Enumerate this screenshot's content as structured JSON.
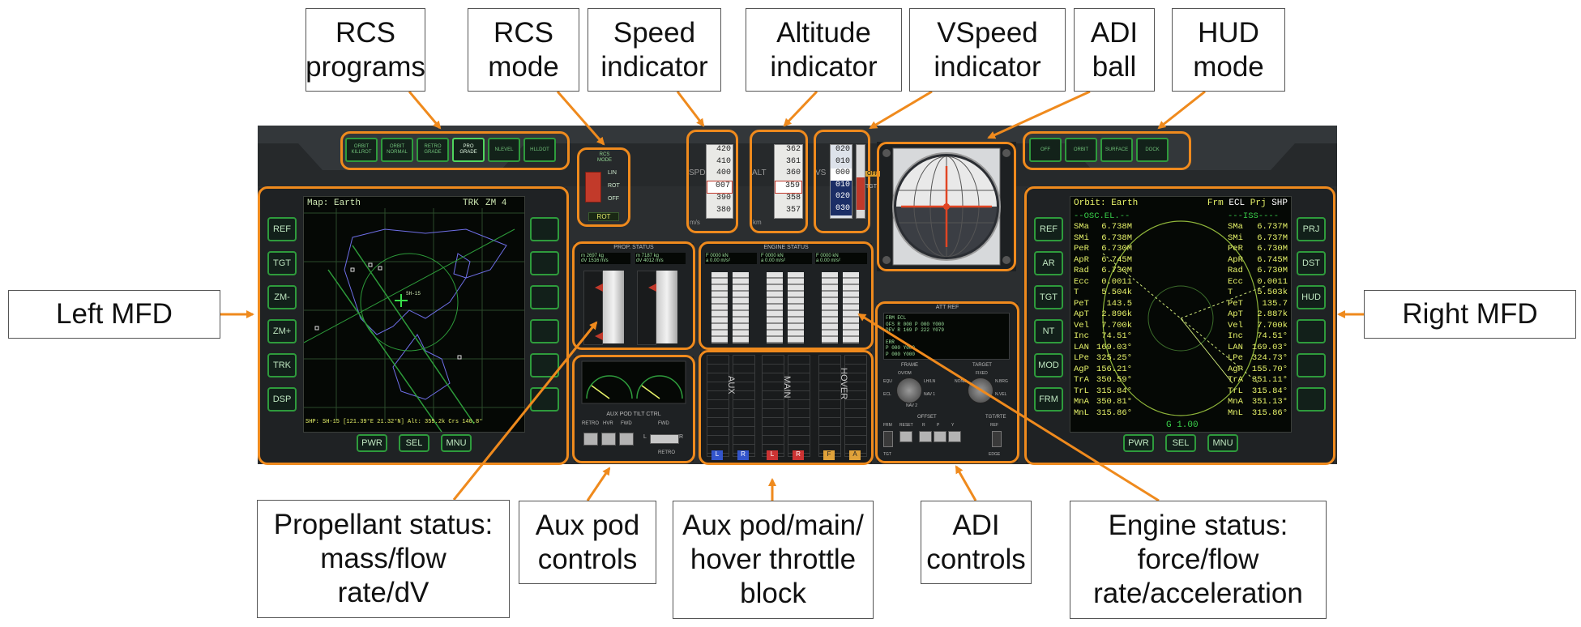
{
  "colors": {
    "highlight": "#ef8a1d",
    "button_green": "#2e9b3c",
    "map_line": "#6f6fe8",
    "orbit_text": "#e8f46a"
  },
  "labels": {
    "rcs_programs": "RCS\nprograms",
    "rcs_mode": "RCS\nmode",
    "speed_indicator": "Speed\nindicator",
    "altitude_indicator": "Altitude\nindicator",
    "vspeed_indicator": "VSpeed\nindicator",
    "adi_ball": "ADI\nball",
    "hud_mode": "HUD\nmode",
    "left_mfd": "Left MFD",
    "right_mfd": "Right MFD",
    "propellant_status": "Propellant status:\nmass/flow\nrate/dV",
    "aux_pod_controls": "Aux pod\ncontrols",
    "throttle_block": "Aux pod/main/\nhover throttle\nblock",
    "adi_controls": "ADI\ncontrols",
    "engine_status": "Engine status:\nforce/flow\nrate/acceleration"
  },
  "rcs_program_buttons": [
    "ORBIT\nKILLROT",
    "ORBIT\nNORMAL",
    "RETRO\nGRADE",
    "PRO\nGRADE",
    "NLEVEL",
    "HLLDOT"
  ],
  "rcs_mode": {
    "title": "RCS\nMODE",
    "lin": "LIN",
    "rot": "ROT",
    "off": "OFF",
    "active": "ROT"
  },
  "hud_buttons": [
    "OFF",
    "ORBIT",
    "SURFACE",
    "DOCK"
  ],
  "left_mfd": {
    "header": "Map: Earth",
    "trk": "TRK",
    "zoom": "ZM 4",
    "footer": "SHP: SH-15 [121.39°E 21.32°N] Alt: 359.2k Crs 140.8°",
    "left_buttons": [
      "REF",
      "TGT",
      "ZM-",
      "ZM+",
      "TRK",
      "DSP"
    ],
    "bottom_buttons": [
      "PWR",
      "SEL",
      "MNU"
    ],
    "target_label": "SH-15"
  },
  "right_mfd": {
    "title": "Orbit: Earth",
    "frm_label": "Frm",
    "frm_value": "ECL",
    "prj_label": "Prj",
    "prj_value": "SHP",
    "osc_header": "--OSC.EL.--",
    "iss_header": "---ISS----",
    "left_col": [
      [
        "SMa",
        "6.738M"
      ],
      [
        "SMi",
        "6.738M"
      ],
      [
        "PeR",
        "6.730M"
      ],
      [
        "ApR",
        "6.745M"
      ],
      [
        "Rad",
        "6.730M"
      ],
      [
        "Ecc",
        "0.0011"
      ],
      [
        "T",
        "5.504k"
      ],
      [
        "PeT",
        "143.5"
      ],
      [
        "ApT",
        "2.896k"
      ],
      [
        "Vel",
        "7.700k"
      ],
      [
        "Inc",
        "74.51°"
      ],
      [
        "LAN",
        "169.03°"
      ],
      [
        "LPe",
        "325.25°"
      ],
      [
        "AgP",
        "156.21°"
      ],
      [
        "TrA",
        "350.59°"
      ],
      [
        "TrL",
        "315.84°"
      ],
      [
        "MnA",
        "350.81°"
      ],
      [
        "MnL",
        "315.86°"
      ]
    ],
    "right_col": [
      [
        "SMa",
        "6.737M"
      ],
      [
        "SMi",
        "6.737M"
      ],
      [
        "PeR",
        "6.730M"
      ],
      [
        "ApR",
        "6.745M"
      ],
      [
        "Rad",
        "6.730M"
      ],
      [
        "Ecc",
        "0.0011"
      ],
      [
        "T",
        "5.503k"
      ],
      [
        "PeT",
        "135.7"
      ],
      [
        "ApT",
        "2.887k"
      ],
      [
        "Vel",
        "7.700k"
      ],
      [
        "Inc",
        "74.51°"
      ],
      [
        "LAN",
        "169.03°"
      ],
      [
        "LPe",
        "324.73°"
      ],
      [
        "AgP",
        "155.70°"
      ],
      [
        "TrA",
        "351.11°"
      ],
      [
        "TrL",
        "315.84°"
      ],
      [
        "MnA",
        "351.13°"
      ],
      [
        "MnL",
        "315.86°"
      ]
    ],
    "gauge_label": "G 1.00",
    "left_buttons": [
      "REF",
      "AR",
      "TGT",
      "NT",
      "MOD",
      "FRM"
    ],
    "right_buttons": [
      "PRJ",
      "DST",
      "HUD"
    ],
    "bottom_buttons": [
      "PWR",
      "SEL",
      "MNU"
    ]
  },
  "speed_tape": {
    "label": "SPD",
    "unit": "m/s",
    "ticks": [
      "420",
      "410",
      "400",
      "007",
      "390",
      "380"
    ]
  },
  "altitude_tape": {
    "label": "ALT",
    "unit": "km",
    "ticks": [
      "362",
      "361",
      "360",
      "359",
      "358",
      "357"
    ]
  },
  "vspeed_tape": {
    "label": "VS",
    "ticks": [
      "020",
      "010",
      "000",
      "010",
      "020",
      "030"
    ]
  },
  "adi": {
    "off_tag": "OFF",
    "tgt_tag": "TGT"
  },
  "prop_status": {
    "title": "PROP. STATUS",
    "readout_left": "m 2697 kg\ndV 1516 m/s",
    "readout_right": "m 7187 kg\ndV 4012 m/s",
    "col_labels": [
      "MASS",
      "FLOW",
      "MASS",
      "FLOW"
    ]
  },
  "engine_status": {
    "title": "ENGINE STATUS",
    "readouts": [
      "F 0000 kN\na 0.00 m/s²",
      "F 0000 kN\na 0.00 m/s²",
      "F 0000 kN\na 0.00 m/s²"
    ]
  },
  "aux_pod": {
    "title": "AUX POD TILT CTRL",
    "labels": [
      "RETRO",
      "HVR",
      "FWD",
      "FWD"
    ],
    "retro": "RETRO",
    "l": "L",
    "r": "R"
  },
  "throttle": {
    "labels": [
      "AUX",
      "MAIN",
      "HOVER"
    ],
    "tags": [
      "L",
      "R",
      "L",
      "R",
      "F",
      "A"
    ]
  },
  "att_ref": {
    "title": "ATT REF",
    "lines": [
      "FRM ECL",
      "OFS R 000  P 000  Y000",
      "DEV R 169  P 222  Y079",
      "",
      "ERR",
      "    P 000  Y000",
      "    P 000  Y000"
    ],
    "frame": "FRAME",
    "target": "TARGET",
    "frame_opts": [
      "OV/OM",
      "LH/LN",
      "EQU",
      "ECL",
      "NAV 1",
      "NAV 2"
    ],
    "target_opts": [
      "NONE",
      "FIXED",
      "N.BRG",
      "N.VEL"
    ],
    "offset": "OFFSET",
    "tgt_rate": "TGT/RTE",
    "offset_buttons": [
      "FRM",
      "RESET",
      "R",
      "P",
      "Y"
    ],
    "ref": "REF",
    "equal": "EDGE",
    "tgt": "TGT"
  }
}
